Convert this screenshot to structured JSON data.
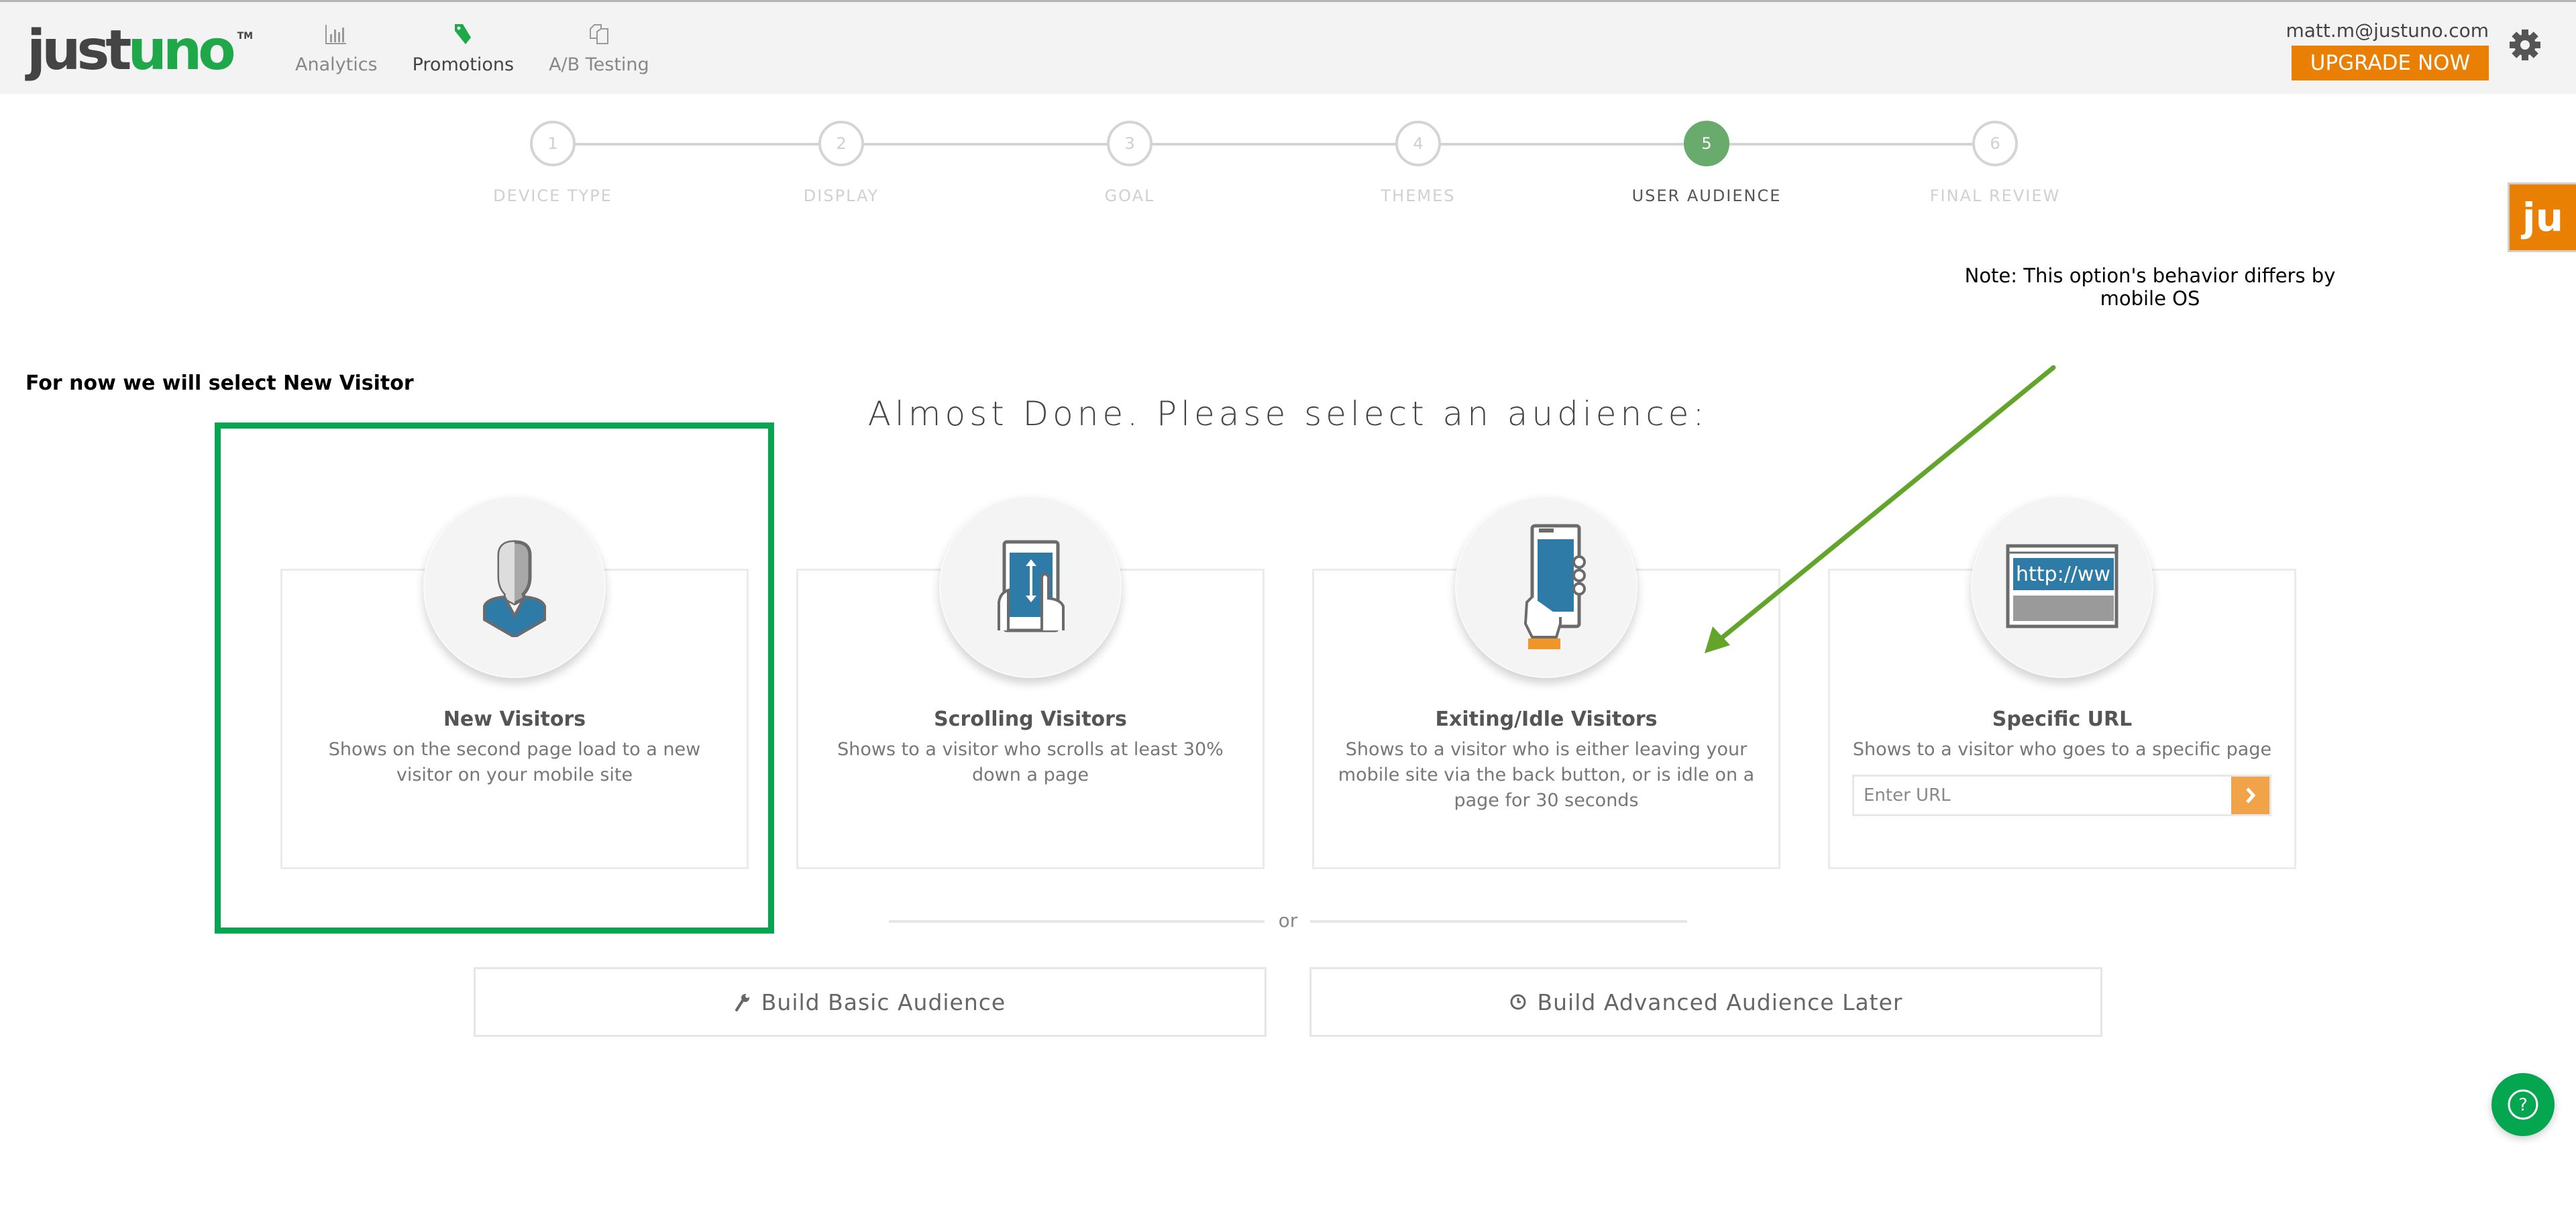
{
  "header": {
    "logo": {
      "part1": "just",
      "part2": "uno",
      "trademark": "TM"
    },
    "nav": [
      {
        "label": "Analytics",
        "icon": "bar-chart-icon",
        "active": false
      },
      {
        "label": "Promotions",
        "icon": "tag-icon",
        "active": true
      },
      {
        "label": "A/B Testing",
        "icon": "copy-icon",
        "active": false
      }
    ],
    "user_email": "matt.m@justuno.com",
    "upgrade_label": "UPGRADE NOW",
    "settings_icon": "gear-icon"
  },
  "side_tab": {
    "label": "ju"
  },
  "stepper": {
    "current_step": 5,
    "steps": [
      {
        "number": "1",
        "label": "DEVICE TYPE"
      },
      {
        "number": "2",
        "label": "DISPLAY"
      },
      {
        "number": "3",
        "label": "GOAL"
      },
      {
        "number": "4",
        "label": "THEMES"
      },
      {
        "number": "5",
        "label": "USER AUDIENCE"
      },
      {
        "number": "6",
        "label": "FINAL REVIEW"
      }
    ]
  },
  "annotations": {
    "callout": "For now we will select New Visitor",
    "note": "Note: This option's behavior differs by mobile OS",
    "arrow_color": "#62a52a",
    "highlight_color": "#04a650",
    "highlighted_card": "New Visitors"
  },
  "main": {
    "title": "Almost Done. Please select an audience:",
    "cards": [
      {
        "title": "New Visitors",
        "description": "Shows on the second page load to a new visitor on your mobile site",
        "icon": "person-icon"
      },
      {
        "title": "Scrolling Visitors",
        "description": "Shows to a visitor who scrolls at least 30% down a page",
        "icon": "tablet-scroll-icon"
      },
      {
        "title": "Exiting/Idle Visitors",
        "description": "Shows to a visitor who is either leaving your mobile site via the back button, or is idle on a page for 30 seconds",
        "icon": "phone-hand-icon"
      },
      {
        "title": "Specific URL",
        "description": "Shows to a visitor who goes to a specific page",
        "icon": "browser-url-icon",
        "url_placeholder": "Enter URL",
        "url_value": "",
        "icon_text": "http://ww"
      }
    ],
    "or_label": "or",
    "build_basic_label": "Build Basic Audience",
    "build_advanced_label": "Build Advanced Audience Later"
  },
  "help": {
    "icon": "help-icon",
    "glyph": "?"
  }
}
